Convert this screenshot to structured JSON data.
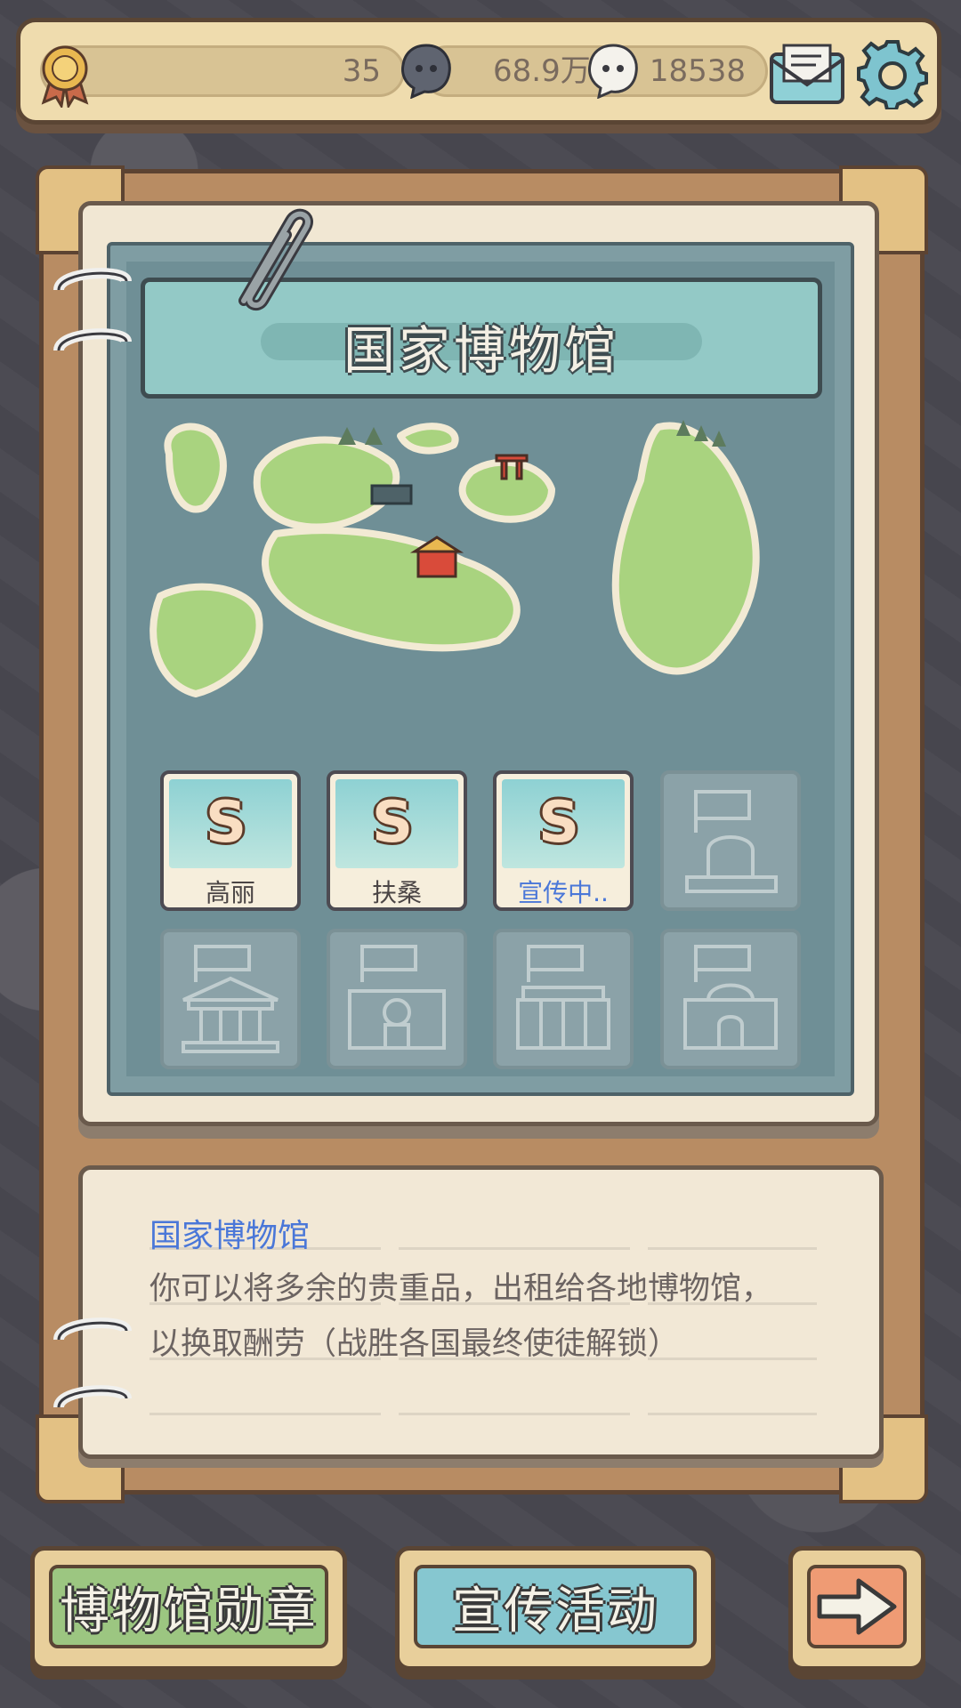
{
  "status_bar": {
    "level": "35",
    "coins": "68.9万",
    "gems": "18538",
    "icons": [
      "medal-icon",
      "dark-blob-icon",
      "white-blob-icon",
      "mail-icon",
      "gear-icon"
    ]
  },
  "museum": {
    "title": "国家博物馆",
    "slots": [
      {
        "name": "高丽",
        "grade": "S",
        "unlocked": true,
        "active": false
      },
      {
        "name": "扶桑",
        "grade": "S",
        "unlocked": true,
        "active": false
      },
      {
        "name": "宣传中..",
        "grade": "S",
        "unlocked": true,
        "active": true
      },
      {
        "name": "",
        "grade": "",
        "unlocked": false,
        "active": false
      },
      {
        "name": "",
        "grade": "",
        "unlocked": false,
        "active": false
      },
      {
        "name": "",
        "grade": "",
        "unlocked": false,
        "active": false
      },
      {
        "name": "",
        "grade": "",
        "unlocked": false,
        "active": false
      },
      {
        "name": "",
        "grade": "",
        "unlocked": false,
        "active": false
      }
    ]
  },
  "description": {
    "title": "国家博物馆",
    "line1": "你可以将多余的贵重品，出租给各地博物馆，",
    "line2": "以换取酬劳（战胜各国最终使徒解锁）"
  },
  "buttons": {
    "medal": "博物馆勋章",
    "promo": "宣传活动",
    "next_icon": "arrow-right-icon"
  },
  "colors": {
    "accent_blue": "#4a77d8",
    "green_button": "#9cc681",
    "teal_button": "#86c7d0",
    "orange_button": "#ef9b74"
  }
}
